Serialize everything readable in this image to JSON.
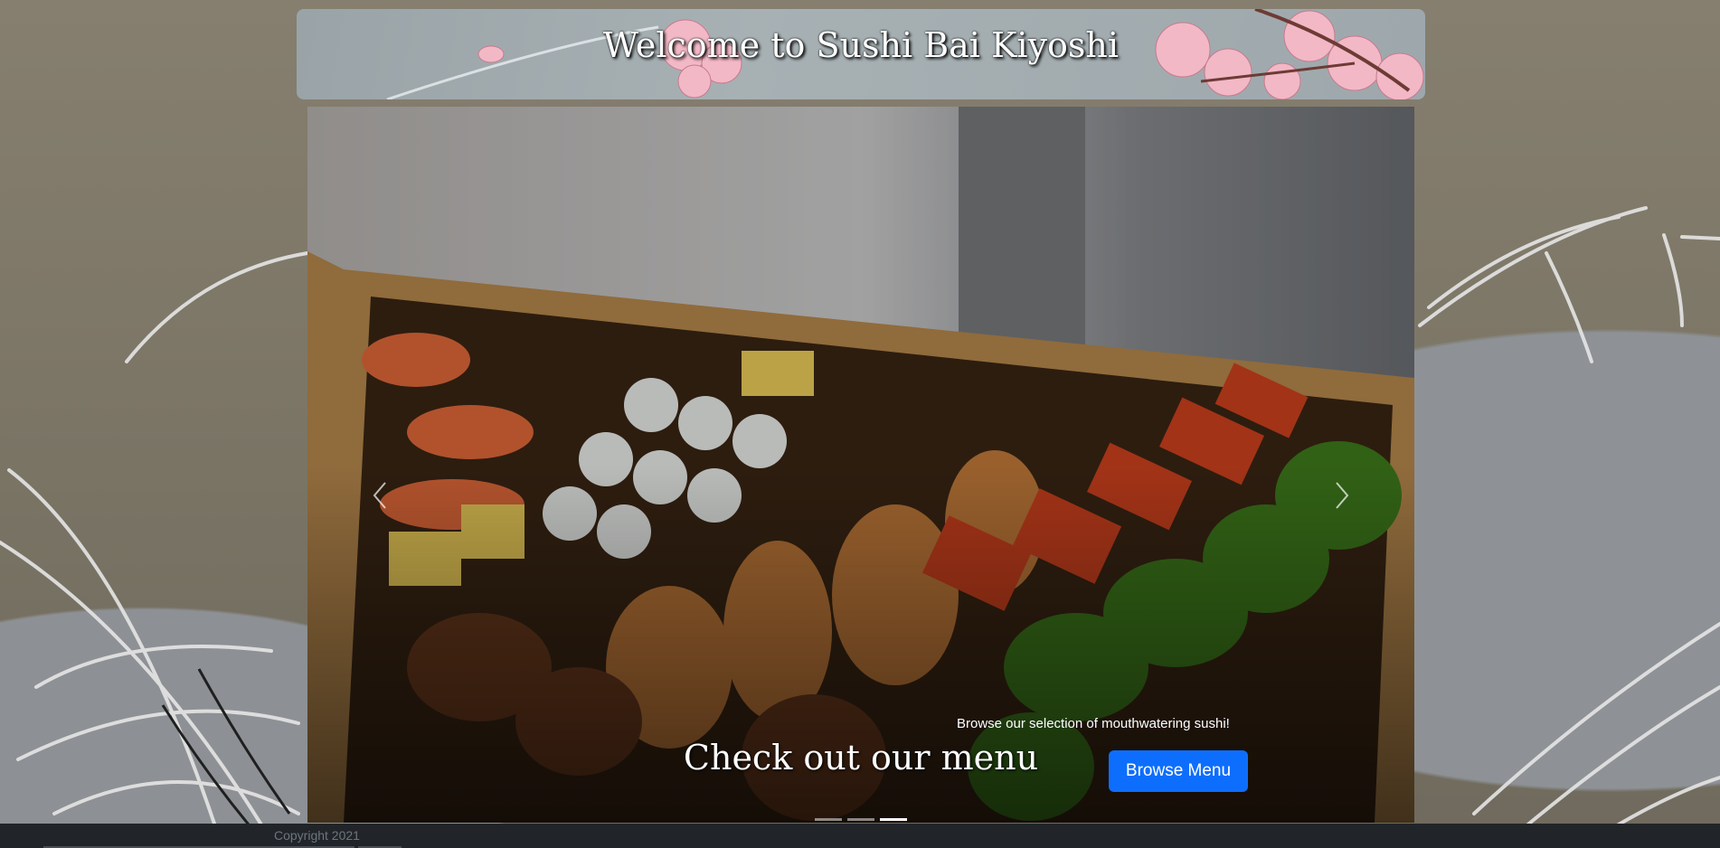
{
  "banner": {
    "title": "Welcome to Sushi Bai Kiyoshi"
  },
  "carousel": {
    "slide_title": "Check out our menu",
    "slide_text": "Browse our selection of mouthwatering sushi!",
    "button_label": "Browse Menu",
    "indicator_count": 3,
    "active_index": 2
  },
  "footer": {
    "copyright": "Copyright 2021"
  },
  "icons": {
    "prev": "chevron-left-icon",
    "next": "chevron-right-icon"
  }
}
